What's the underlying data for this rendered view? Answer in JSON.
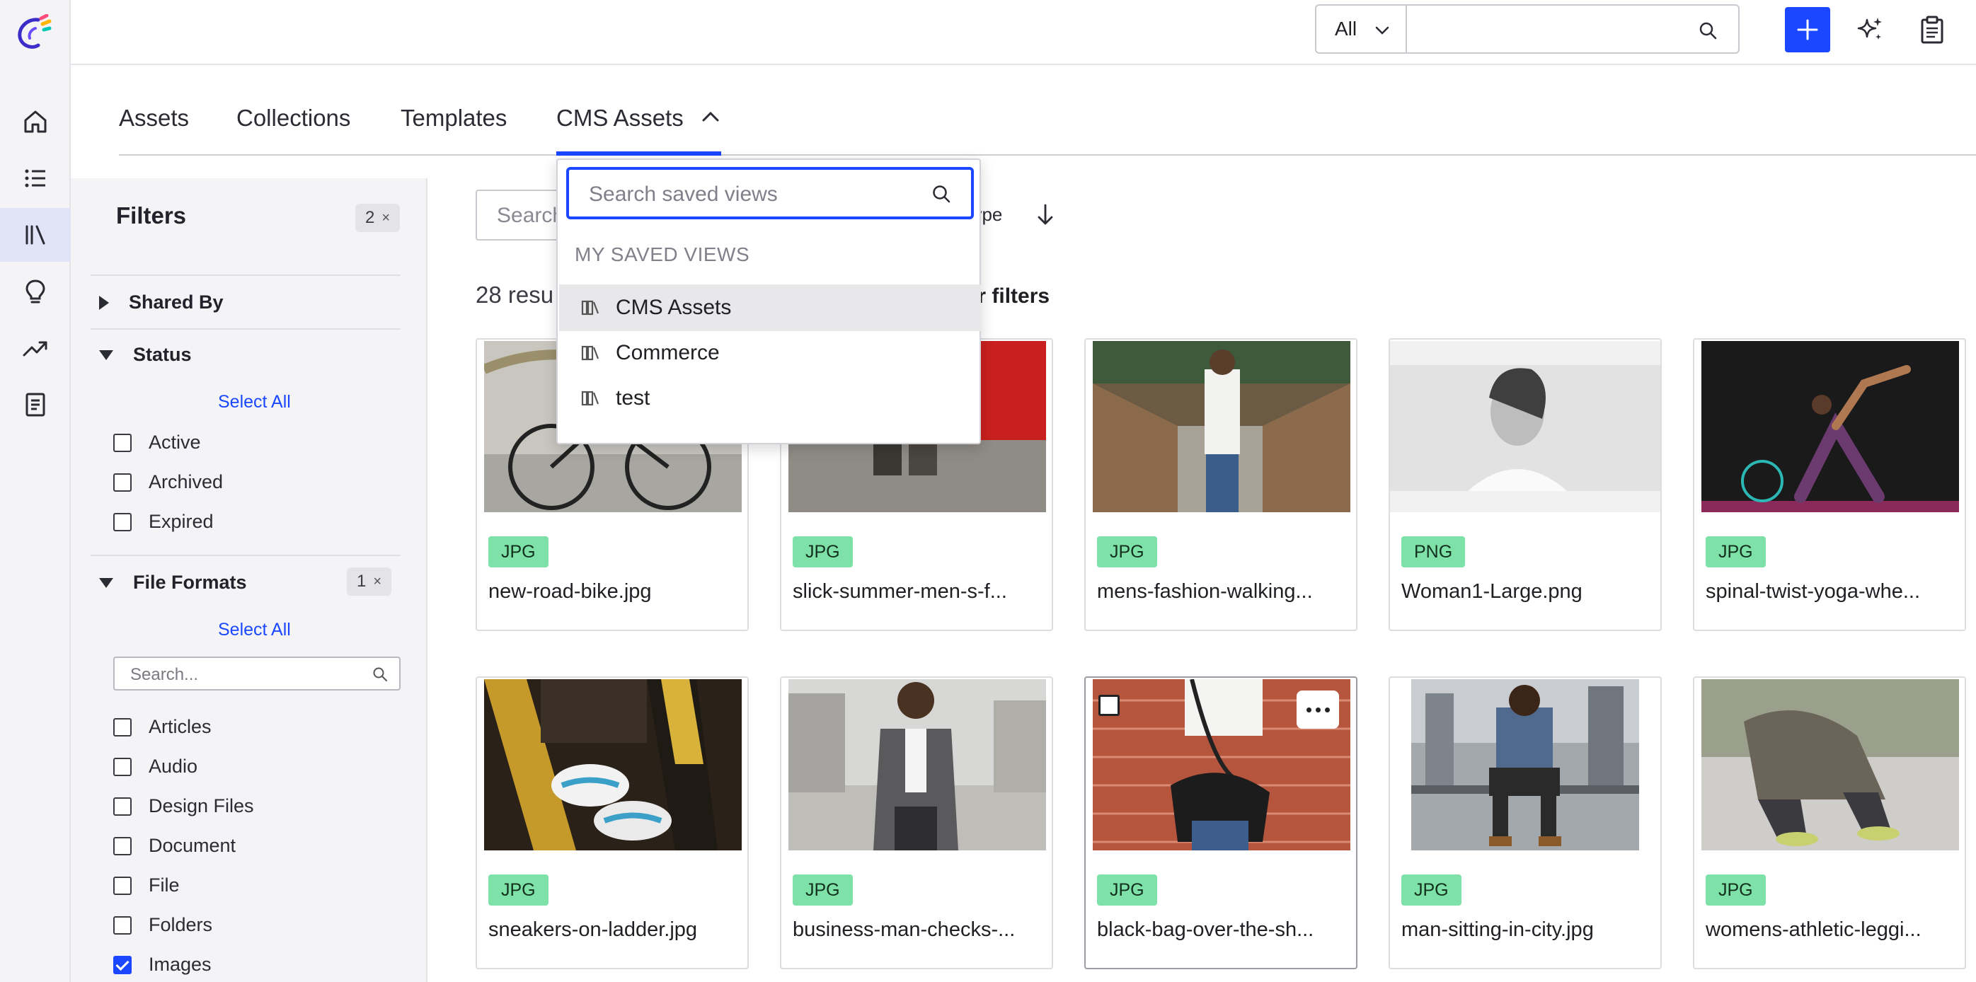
{
  "topbar": {
    "scope": "All",
    "search_value": ""
  },
  "tabs": [
    {
      "label": "Assets"
    },
    {
      "label": "Collections"
    },
    {
      "label": "Templates"
    },
    {
      "label": "CMS Assets"
    }
  ],
  "filters": {
    "title": "Filters",
    "count": "2",
    "clear_symbol": "×",
    "sections": {
      "shared_by": {
        "label": "Shared By"
      },
      "status": {
        "label": "Status",
        "select_all": "Select All",
        "options": [
          {
            "label": "Active",
            "checked": false
          },
          {
            "label": "Archived",
            "checked": false
          },
          {
            "label": "Expired",
            "checked": false
          }
        ]
      },
      "file_formats": {
        "label": "File Formats",
        "count": "1",
        "select_all": "Select All",
        "search_placeholder": "Search...",
        "options": [
          {
            "label": "Articles",
            "checked": false
          },
          {
            "label": "Audio",
            "checked": false
          },
          {
            "label": "Design Files",
            "checked": false
          },
          {
            "label": "Document",
            "checked": false
          },
          {
            "label": "File",
            "checked": false
          },
          {
            "label": "Folders",
            "checked": false
          },
          {
            "label": "Images",
            "checked": true
          }
        ]
      }
    }
  },
  "main": {
    "search_placeholder": "Search",
    "sort_label": "Type",
    "results_text": "28 resu",
    "clear_filters": "ear filters"
  },
  "saved_views": {
    "search_placeholder": "Search saved views",
    "header": "MY SAVED VIEWS",
    "items": [
      {
        "label": "CMS Assets"
      },
      {
        "label": "Commerce"
      },
      {
        "label": "test"
      }
    ]
  },
  "assets": [
    {
      "type": "JPG",
      "name": "new-road-bike.jpg"
    },
    {
      "type": "JPG",
      "name": "slick-summer-men-s-f..."
    },
    {
      "type": "JPG",
      "name": "mens-fashion-walking..."
    },
    {
      "type": "PNG",
      "name": "Woman1-Large.png"
    },
    {
      "type": "JPG",
      "name": "spinal-twist-yoga-whe..."
    },
    {
      "type": "JPG",
      "name": "sneakers-on-ladder.jpg"
    },
    {
      "type": "JPG",
      "name": "business-man-checks-..."
    },
    {
      "type": "JPG",
      "name": "black-bag-over-the-sh..."
    },
    {
      "type": "JPG",
      "name": "man-sitting-in-city.jpg"
    },
    {
      "type": "JPG",
      "name": "womens-athletic-leggi..."
    }
  ],
  "colors": {
    "accent": "#1a47ff",
    "badge": "#7ee2a8",
    "rail_bg": "#f4f4f6"
  }
}
